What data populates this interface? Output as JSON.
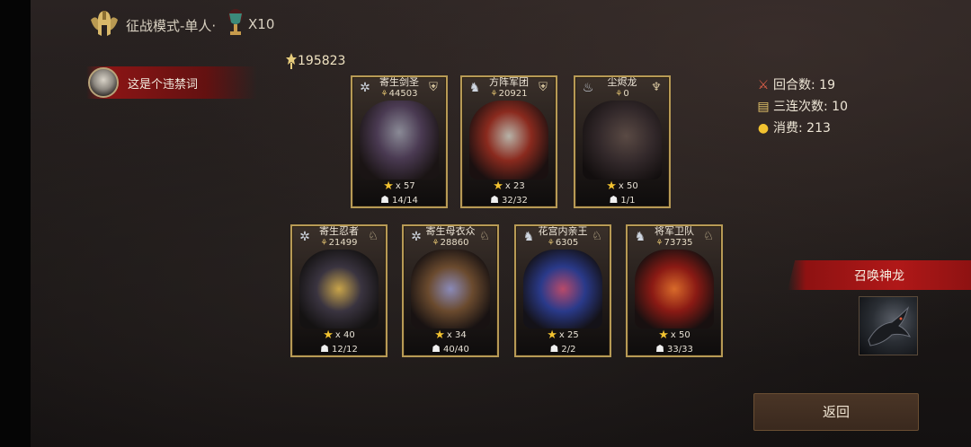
{
  "header": {
    "mode_title": "征战模式-单人·",
    "trophy_count": "X10",
    "mode_emblem_icon": "spartan-helmet-emblem-icon",
    "trophy_icon": "trophy-icon"
  },
  "player": {
    "name": "这是个违禁词",
    "avatar_icon": "player-avatar"
  },
  "total_power": "195823",
  "cards": [
    {
      "name": "寄生剑圣",
      "power": "44503",
      "stars": "x 57",
      "troops": "14/14",
      "left_icon": "frost-star-icon",
      "right_icon": "shield-icon"
    },
    {
      "name": "方阵军团",
      "power": "20921",
      "stars": "x 23",
      "troops": "32/32",
      "left_icon": "horse-icon",
      "right_icon": "shield-icon"
    },
    {
      "name": "尘烬龙",
      "power": "0",
      "stars": "x 50",
      "troops": "1/1",
      "left_icon": "flame-icon",
      "right_icon": "dragon-crest-icon"
    },
    {
      "name": "寄生忍者",
      "power": "21499",
      "stars": "x 40",
      "troops": "12/12",
      "left_icon": "frost-star-icon",
      "right_icon": "horse-head-icon"
    },
    {
      "name": "寄生母衣众",
      "power": "28860",
      "stars": "x 34",
      "troops": "40/40",
      "left_icon": "frost-star-icon",
      "right_icon": "horse-head-icon"
    },
    {
      "name": "花宫内亲王",
      "power": "6305",
      "stars": "x 25",
      "troops": "2/2",
      "left_icon": "horse-icon",
      "right_icon": "horse-head-icon"
    },
    {
      "name": "将军卫队",
      "power": "73735",
      "stars": "x 50",
      "troops": "33/33",
      "left_icon": "horse-icon",
      "right_icon": "horse-head-icon"
    }
  ],
  "stats": {
    "rounds": "回合数: 19",
    "triple_combo": "三连次数: 10",
    "consumption": "消费: 213"
  },
  "summon": {
    "label": "召唤神龙",
    "dragon_icon": "dragon-thumbnail"
  },
  "back_label": "返回",
  "colors": {
    "card_border": "#b79a55",
    "banner_red": "#b01818",
    "star_gold": "#f2c230",
    "back_button": "#3a291e"
  }
}
